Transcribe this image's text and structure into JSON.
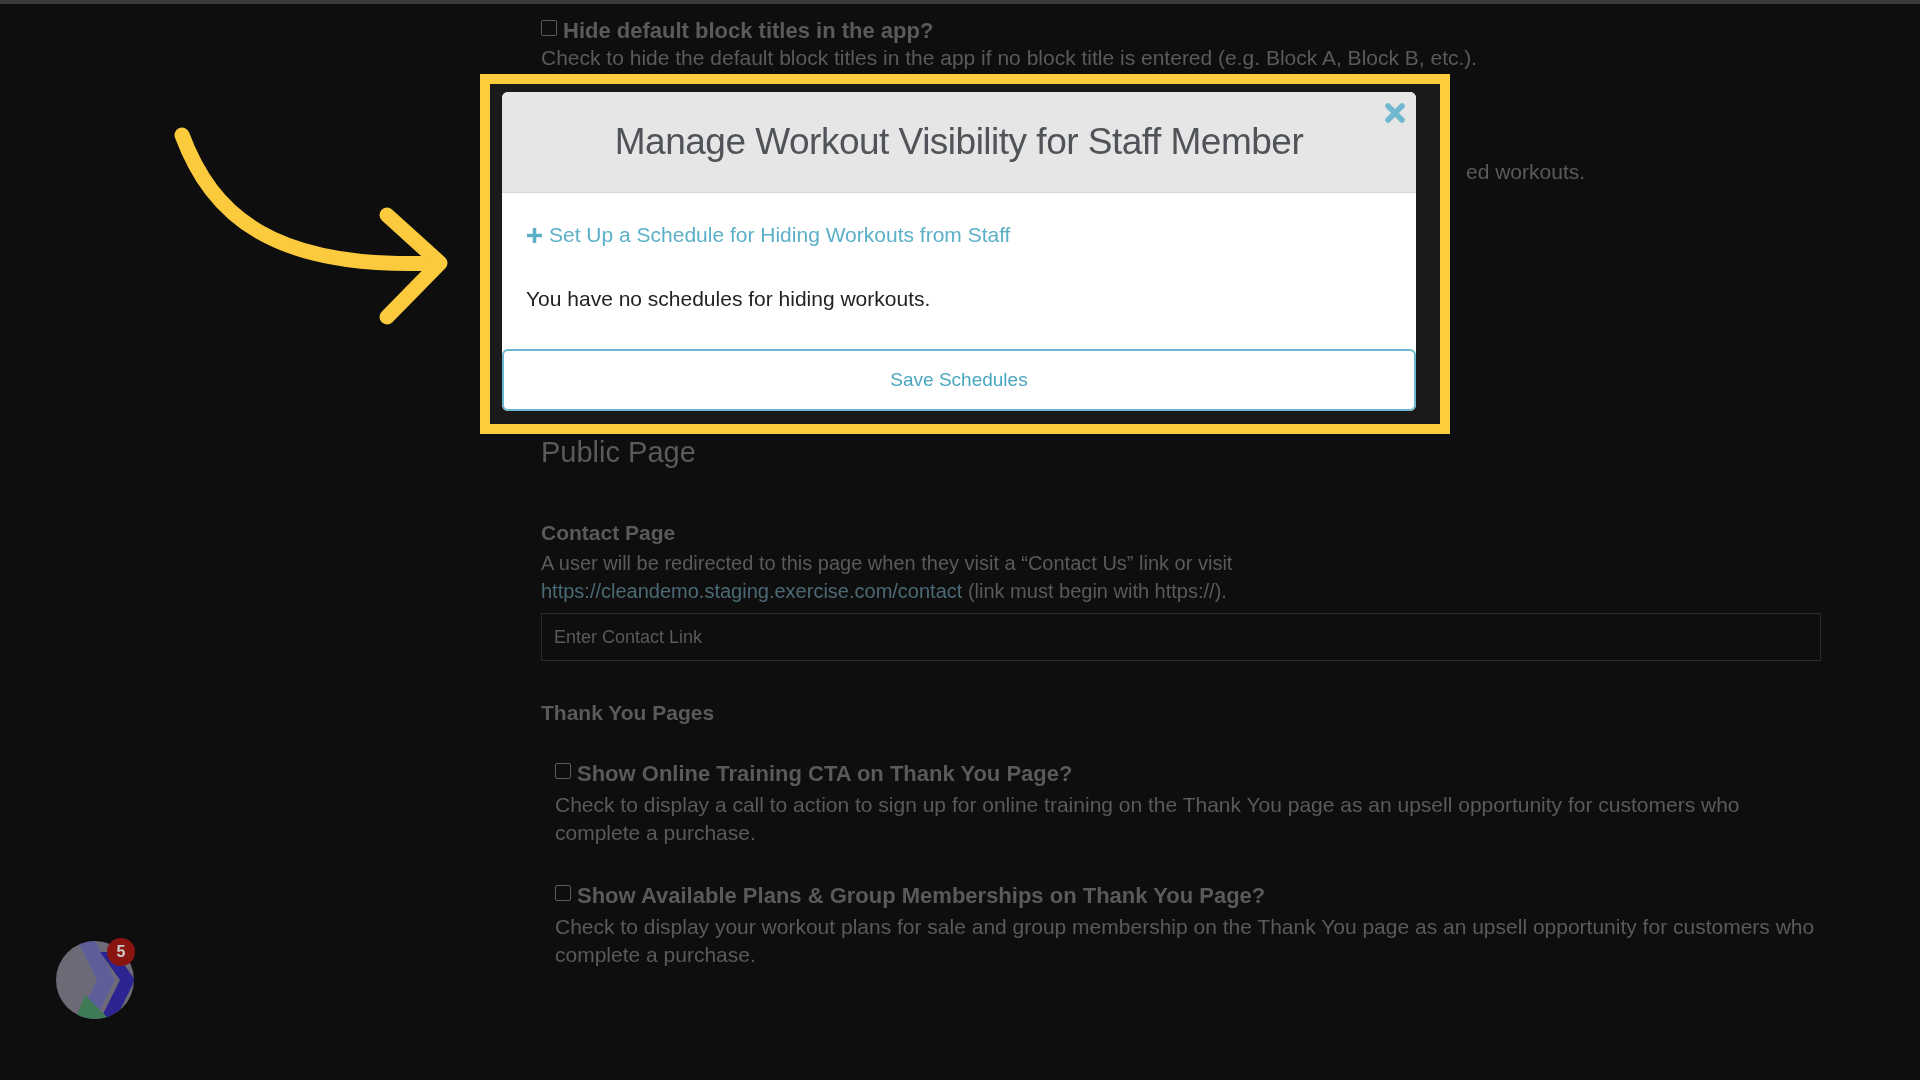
{
  "background_page": {
    "block_titles_option": {
      "label": "Hide default block titles in the app?",
      "checked": false,
      "description": "Check to hide the default block titles in the app if no block title is entered (e.g. Block A, Block B, etc.)."
    },
    "partial_text": "ed workouts.",
    "public_page": {
      "heading": "Public Page",
      "contact_page": {
        "heading": "Contact Page",
        "description": "A user will be redirected to this page when they visit a “Contact Us” link or visit ",
        "link": "https://cleandemo.staging.exercise.com/contact",
        "description_end": " (link must begin with https://).",
        "field": {
          "placeholder": "Enter Contact Link"
        }
      },
      "thank_you_pages": {
        "heading": "Thank You Pages",
        "options": [
          {
            "label": "Show Online Training CTA on Thank You Page?",
            "checked": false,
            "description": "Check to display a call to action to sign up for online training on the Thank You page as an upsell opportunity for customers who complete a purchase."
          },
          {
            "label": "Show Available Plans & Group Memberships on Thank You Page?",
            "checked": false,
            "description": "Check to display your workout plans for sale and group membership on the Thank You page as an upsell opportunity for customers who complete a purchase."
          }
        ]
      }
    }
  },
  "modal": {
    "title": "Manage Workout Visibility for Staff Member",
    "add_link": "Set Up a Schedule for Hiding Workouts from Staff",
    "empty_message": "You have no schedules for hiding workouts.",
    "save_button": "Save Schedules"
  },
  "chat_widget": {
    "badge": "5"
  }
}
